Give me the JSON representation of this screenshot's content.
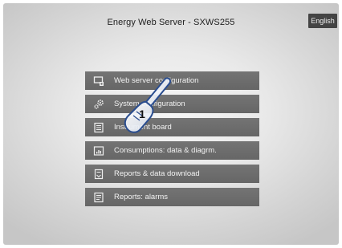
{
  "header": {
    "title": "Energy Web Server - SXWS255",
    "language_label": "English"
  },
  "menu": {
    "items": [
      {
        "label": "Web server configuration",
        "icon": "monitor-config-icon"
      },
      {
        "label": "System configuration",
        "icon": "gears-icon"
      },
      {
        "label": "Instrument board",
        "icon": "instrument-board-icon"
      },
      {
        "label": "Consumptions: data & diagrm.",
        "icon": "chart-icon"
      },
      {
        "label": "Reports & data download",
        "icon": "report-download-icon"
      },
      {
        "label": "Reports: alarms",
        "icon": "report-alarms-icon"
      }
    ]
  },
  "overlay": {
    "step_number": "1",
    "icon": "pointing-hand-icon"
  }
}
